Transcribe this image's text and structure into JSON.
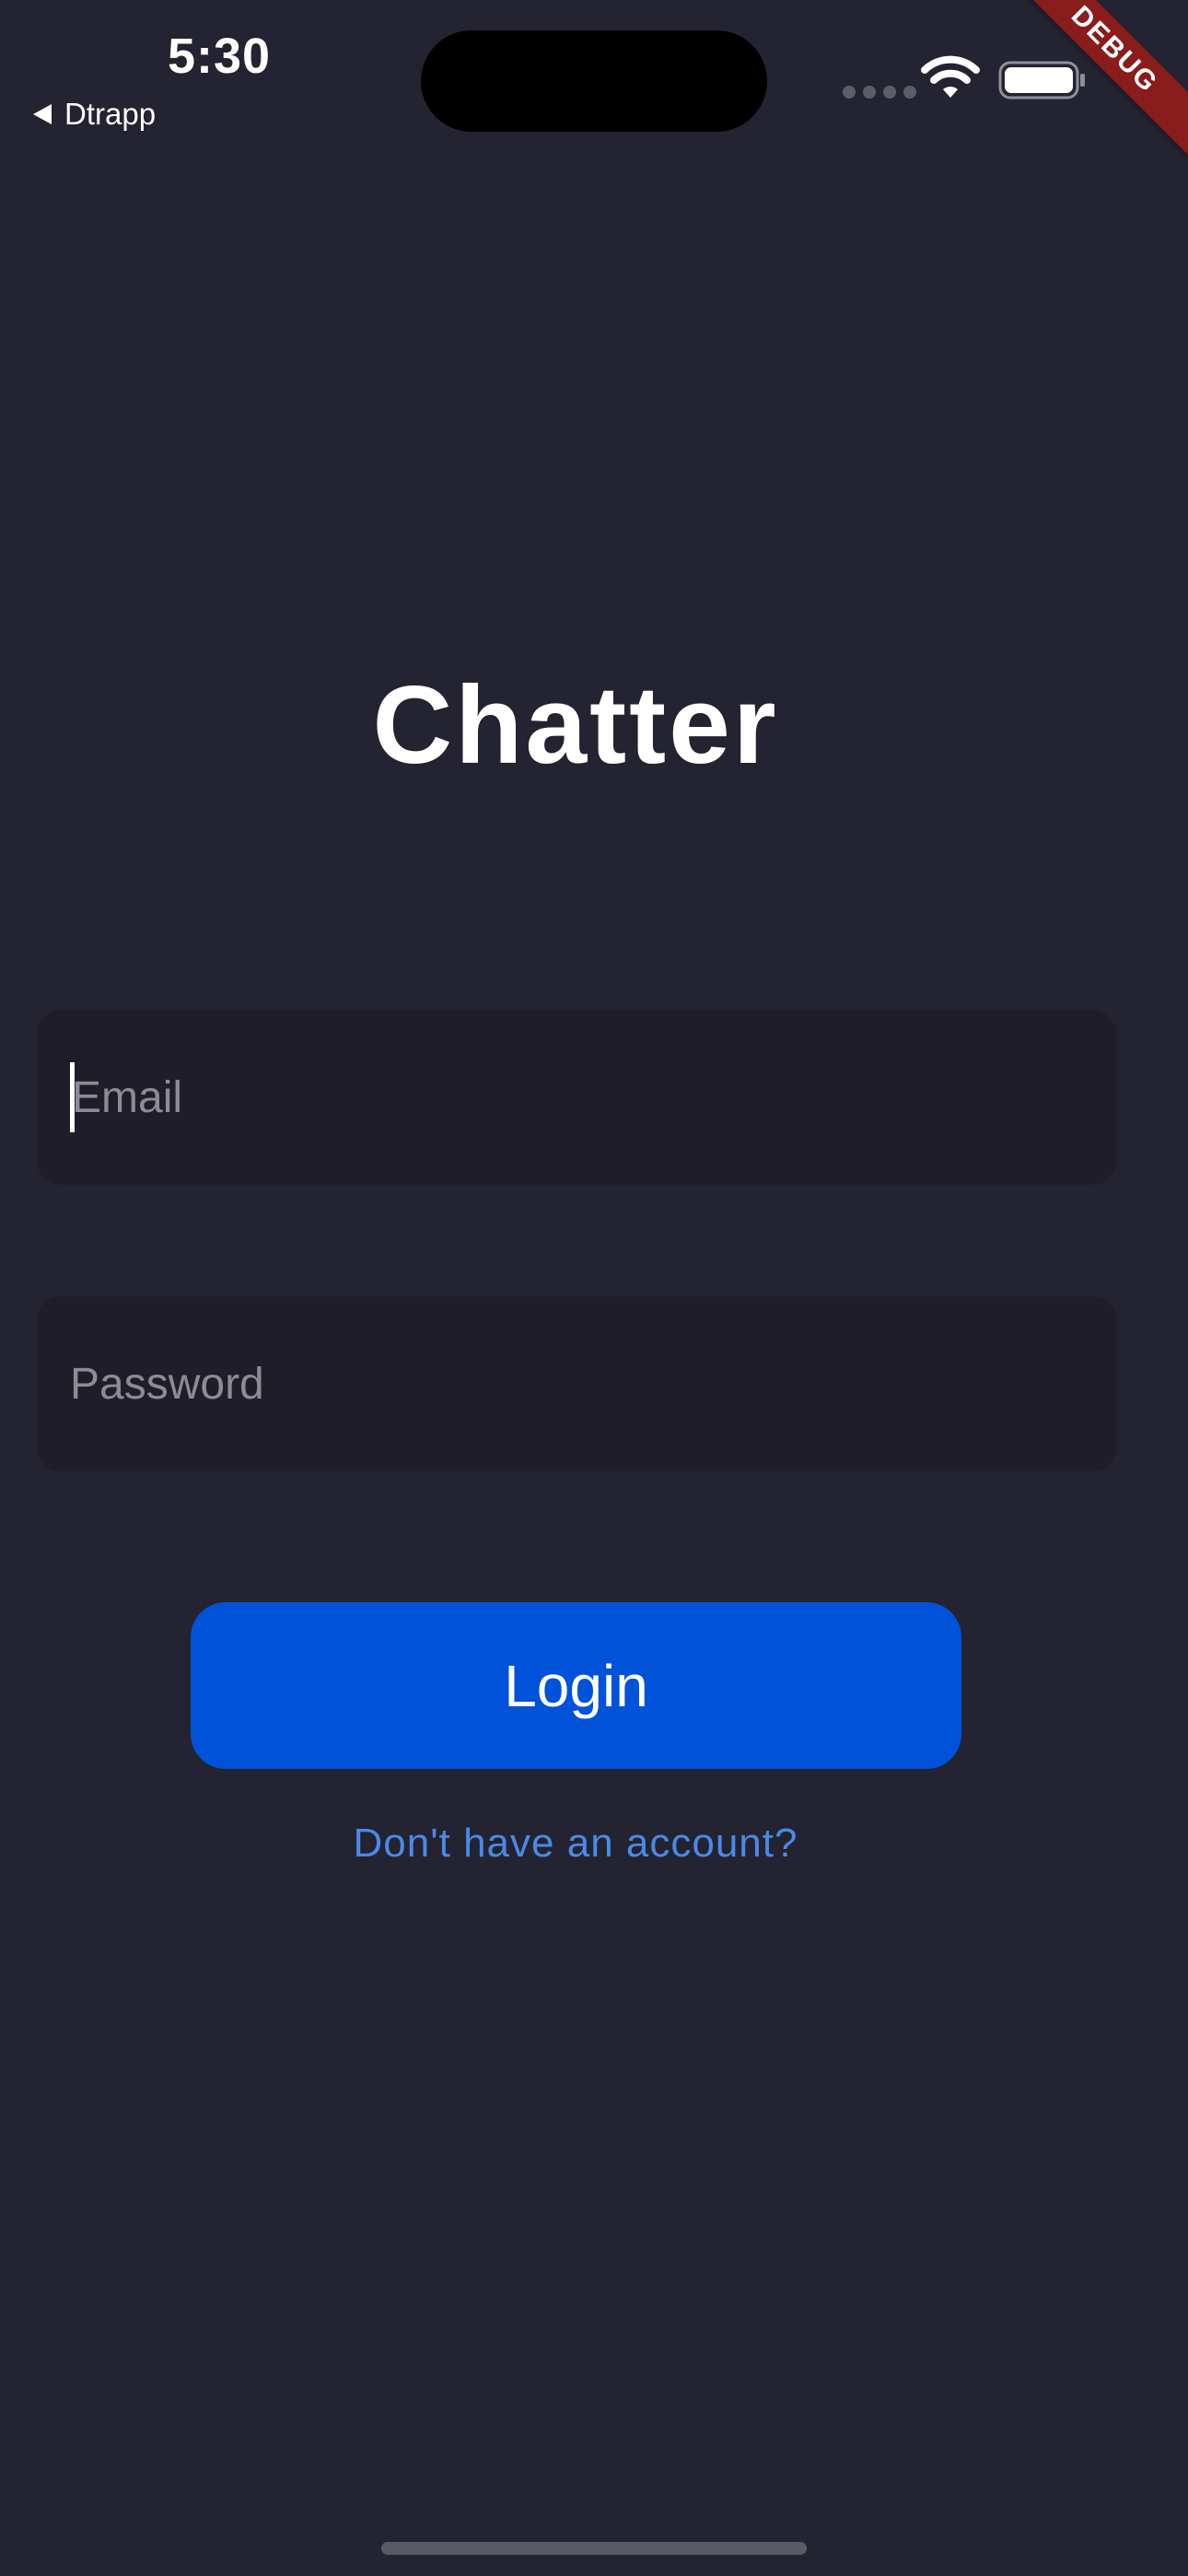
{
  "status_bar": {
    "time": "5:30",
    "back_app": "Dtrapp",
    "icons": [
      "signal-dots-icon",
      "wifi-icon",
      "battery-icon"
    ]
  },
  "debug_banner": {
    "label": "DEBUG",
    "color": "#8a1c1c"
  },
  "login_screen": {
    "title": "Chatter",
    "email": {
      "placeholder": "Email",
      "value": ""
    },
    "password": {
      "placeholder": "Password",
      "value": ""
    },
    "login_button_label": "Login",
    "signup_link_label": "Don't have an account?"
  },
  "colors": {
    "background": "#232331",
    "input_background": "#1f1e28",
    "primary_button": "#0052d9",
    "link": "#4a89e8",
    "placeholder_text": "#8d8c94"
  }
}
